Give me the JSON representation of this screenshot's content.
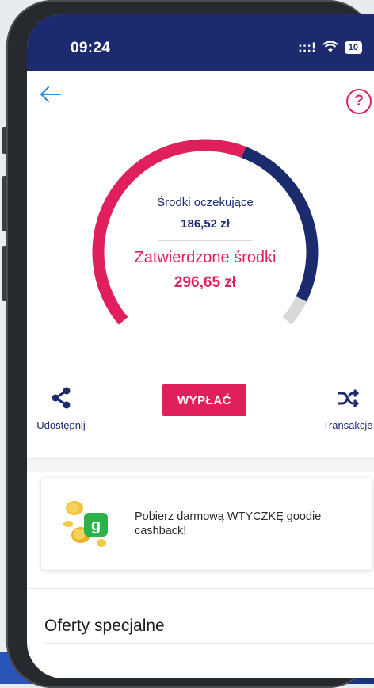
{
  "status_bar": {
    "time": "09:24",
    "signal": ":::!",
    "wifi": "wifi-icon",
    "battery": "10"
  },
  "header": {
    "back_icon": "arrow-left-icon",
    "help_label": "?"
  },
  "gauge": {
    "pending_label": "Środki oczekujące",
    "pending_value": "186,52 zł",
    "approved_label": "Zatwierdzone środki",
    "approved_value": "296,65 zł",
    "colors": {
      "approved": "#e0205c",
      "pending": "#1c2a6e",
      "remaining": "#d9d9d9"
    }
  },
  "actions": {
    "share_label": "Udostępnij",
    "withdraw_label": "WYPŁAĆ",
    "transactions_label": "Transakcje"
  },
  "promo": {
    "text": "Pobierz darmową WTYCZKĘ goodie cashback!",
    "badge": "g"
  },
  "offers": {
    "title": "Oferty specjalne"
  }
}
